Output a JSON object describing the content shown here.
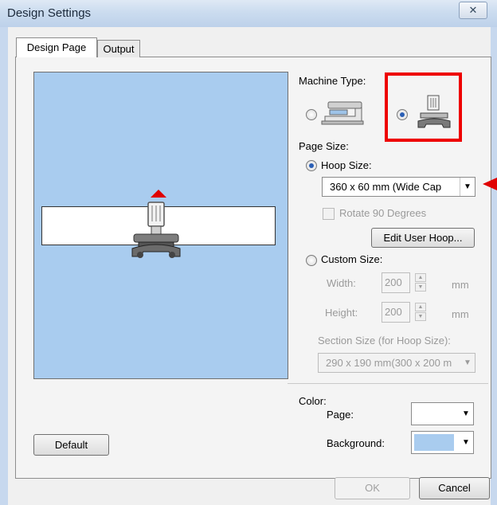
{
  "window": {
    "title": "Design Settings",
    "close_glyph": "✕"
  },
  "tabs": [
    {
      "label": "Design Page"
    },
    {
      "label": "Output"
    }
  ],
  "machine_type": {
    "label": "Machine Type:",
    "options": [
      "embroidery-sewing-machine-icon",
      "cap-embroidery-machine-icon"
    ],
    "selected": 1
  },
  "page_size": {
    "label": "Page Size:",
    "hoop_size_label": "Hoop Size:",
    "hoop_value": "360 x  60 mm (Wide Cap",
    "rotate_label": "Rotate 90 Degrees",
    "edit_hoop_label": "Edit User Hoop...",
    "custom_size_label": "Custom Size:",
    "width_label": "Width:",
    "width_value": "200",
    "height_label": "Height:",
    "height_value": "200",
    "unit": "mm",
    "section_label": "Section Size (for Hoop Size):",
    "section_value": "290 x 190 mm(300 x 200 m"
  },
  "color": {
    "label": "Color:",
    "page_label": "Page:",
    "page_color": "#ffffff",
    "background_label": "Background:",
    "background_color": "#a9ccef"
  },
  "buttons": {
    "default": "Default",
    "ok": "OK",
    "cancel": "Cancel"
  },
  "accent": {
    "highlight": "#ee0000"
  }
}
